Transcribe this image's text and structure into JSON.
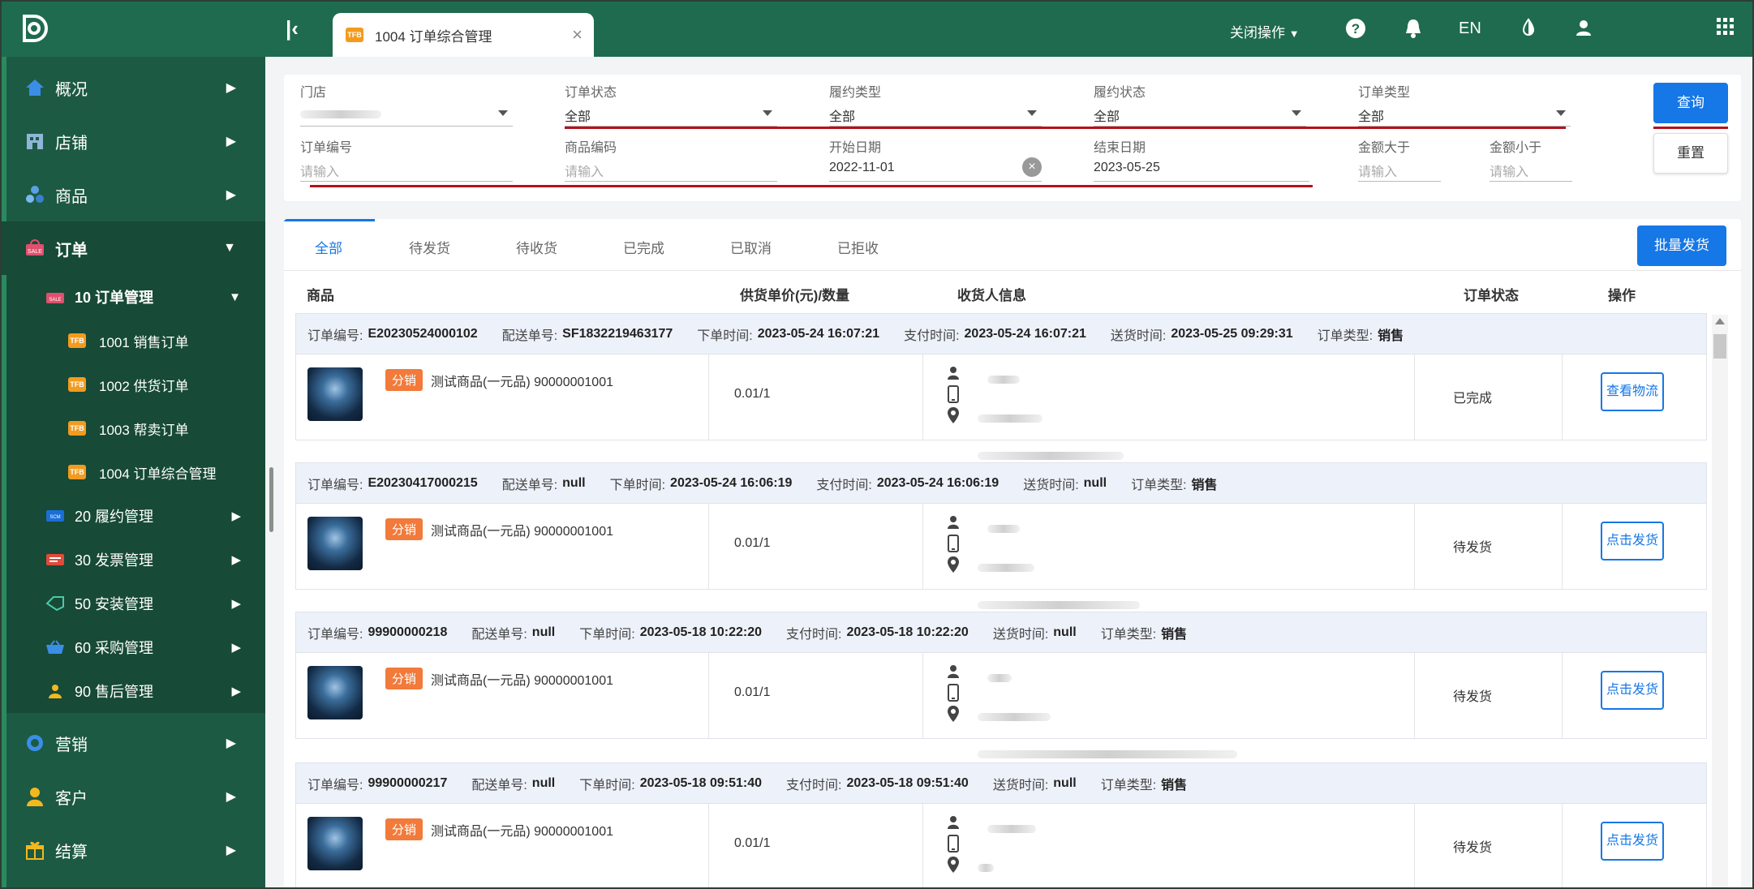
{
  "topbar": {
    "tab_label": "1004 订单综合管理",
    "tab_icon": "TFB",
    "close_ops": "关闭操作",
    "lang": "EN"
  },
  "sidebar": {
    "items": [
      {
        "label": "概况",
        "icon": "home-icon"
      },
      {
        "label": "店铺",
        "icon": "store-icon"
      },
      {
        "label": "商品",
        "icon": "goods-icon"
      },
      {
        "label": "订单",
        "icon": "sale-icon"
      },
      {
        "label": "营销",
        "icon": "marketing-icon"
      },
      {
        "label": "客户",
        "icon": "customer-icon"
      },
      {
        "label": "结算",
        "icon": "gift-icon"
      }
    ],
    "order_sub": [
      {
        "label": "10 订单管理"
      },
      {
        "label": "20 履约管理"
      },
      {
        "label": "30 发票管理"
      },
      {
        "label": "50 安装管理"
      },
      {
        "label": "60 采购管理"
      },
      {
        "label": "90 售后管理"
      }
    ],
    "order_mgmt_sub": [
      {
        "label": "1001 销售订单"
      },
      {
        "label": "1002 供货订单"
      },
      {
        "label": "1003 帮卖订单"
      },
      {
        "label": "1004 订单综合管理"
      }
    ]
  },
  "filter": {
    "store_label": "门店",
    "order_status_label": "订单状态",
    "order_status_value": "全部",
    "fulfill_type_label": "履约类型",
    "fulfill_type_value": "全部",
    "fulfill_status_label": "履约状态",
    "fulfill_status_value": "全部",
    "order_type_label": "订单类型",
    "order_type_value": "全部",
    "order_no_label": "订单编号",
    "order_no_placeholder": "请输入",
    "goods_code_label": "商品编码",
    "goods_code_placeholder": "请输入",
    "start_date_label": "开始日期",
    "start_date_value": "2022-11-01",
    "end_date_label": "结束日期",
    "end_date_value": "2023-05-25",
    "amount_gt_label": "金额大于",
    "amount_gt_placeholder": "请输入",
    "amount_lt_label": "金额小于",
    "amount_lt_placeholder": "请输入",
    "query_label": "查询",
    "reset_label": "重置"
  },
  "main": {
    "tabs": [
      "全部",
      "待发货",
      "待收货",
      "已完成",
      "已取消",
      "已拒收"
    ],
    "batch_label": "批量发货",
    "headers": {
      "goods": "商品",
      "price_qty": "供货单价(元)/数量",
      "receiver": "收货人信息",
      "status": "订单状态",
      "ops": "操作"
    },
    "order_labels": {
      "order_no": "订单编号:",
      "delivery_no": "配送单号:",
      "order_time": "下单时间:",
      "pay_time": "支付时间:",
      "ship_time": "送货时间:",
      "order_type": "订单类型:"
    },
    "orders": [
      {
        "order_no": "E20230524000102",
        "delivery_no": "SF1832219463177",
        "order_time": "2023-05-24 16:07:21",
        "pay_time": "2023-05-24 16:07:21",
        "ship_time": "2023-05-25 09:29:31",
        "order_type": "销售",
        "badge": "分销",
        "goods": "测试商品(一元品) 90000001001",
        "price_qty": "0.01/1",
        "status": "已完成",
        "action": "查看物流"
      },
      {
        "order_no": "E20230417000215",
        "delivery_no": "null",
        "order_time": "2023-05-24 16:06:19",
        "pay_time": "2023-05-24 16:06:19",
        "ship_time": "null",
        "order_type": "销售",
        "badge": "分销",
        "goods": "测试商品(一元品) 90000001001",
        "price_qty": "0.01/1",
        "status": "待发货",
        "action": "点击发货"
      },
      {
        "order_no": "99900000218",
        "delivery_no": "null",
        "order_time": "2023-05-18 10:22:20",
        "pay_time": "2023-05-18 10:22:20",
        "ship_time": "null",
        "order_type": "销售",
        "badge": "分销",
        "goods": "测试商品(一元品) 90000001001",
        "price_qty": "0.01/1",
        "status": "待发货",
        "action": "点击发货"
      },
      {
        "order_no": "99900000217",
        "delivery_no": "null",
        "order_time": "2023-05-18 09:51:40",
        "pay_time": "2023-05-18 09:51:40",
        "ship_time": "null",
        "order_type": "销售",
        "badge": "分销",
        "goods": "测试商品(一元品) 90000001001",
        "price_qty": "0.01/1",
        "status": "待发货",
        "action": "点击发货"
      }
    ]
  },
  "colors": {
    "topbar": "#1f6b4f",
    "sidebar": "#1d5a43",
    "primary": "#1677e6",
    "badge": "#f27a3a",
    "annotation_red": "#b3121b"
  }
}
